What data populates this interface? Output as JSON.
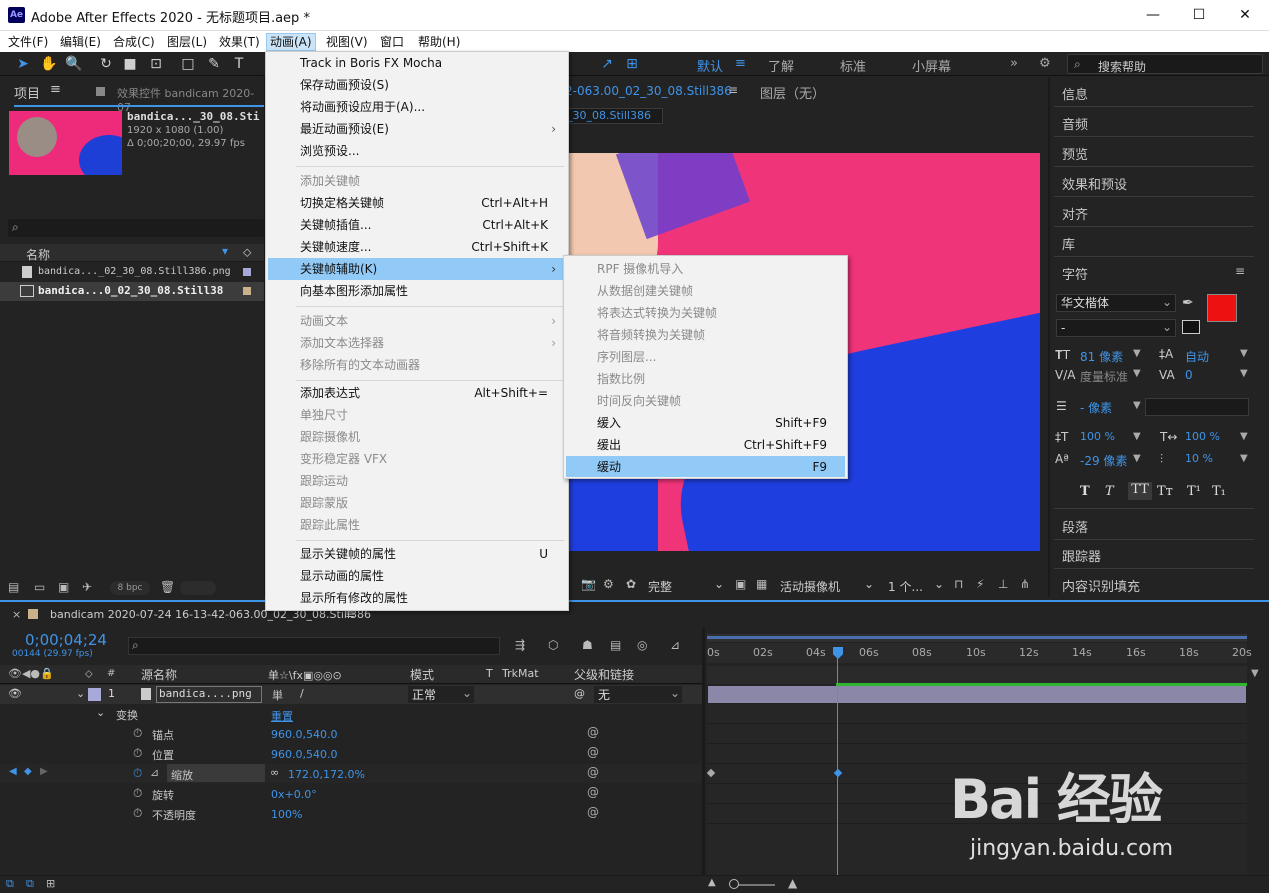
{
  "window": {
    "app_logo": "Ae",
    "title": "Adobe After Effects 2020 - 无标题项目.aep *",
    "minimize": "—",
    "maximize": "☐",
    "close": "✕"
  },
  "menubar": [
    {
      "label": "文件(F)"
    },
    {
      "label": "编辑(E)"
    },
    {
      "label": "合成(C)"
    },
    {
      "label": "图层(L)"
    },
    {
      "label": "效果(T)"
    },
    {
      "label": "动画(A)"
    },
    {
      "label": "视图(V)"
    },
    {
      "label": "窗口"
    },
    {
      "label": "帮助(H)"
    }
  ],
  "toolbar": {
    "workspaces": [
      "默认",
      "了解",
      "标准",
      "小屏幕"
    ],
    "search_placeholder": "搜索帮助"
  },
  "project_panel": {
    "tab_project": "项目",
    "tab_effects": "效果控件 bandicam 2020-07",
    "file_name": "bandica..._30_08.Sti",
    "file_dims": "1920 x 1080 (1.00)",
    "file_duration": "Δ 0;00;20;00, 29.97 fps",
    "column_name": "名称",
    "items": [
      {
        "name": "bandica..._02_30_08.Still386.png"
      },
      {
        "name": "bandica...0_02_30_08.Still38"
      }
    ],
    "bpc": "8 bpc"
  },
  "viewer": {
    "comp_tab": "2-063.00_02_30_08.Still386",
    "layer_tab": "图层（无）",
    "sub_tab": "_30_08.Still386",
    "quality": "完整",
    "camera": "活动摄像机",
    "views": "1 个..."
  },
  "right_panel": {
    "items": [
      "信息",
      "音频",
      "预览",
      "效果和预设",
      "对齐",
      "库"
    ],
    "character_title": "字符",
    "font_name": "华文楷体",
    "font_style": "-",
    "font_size": "81 像素",
    "leading": "自动",
    "kerning": "度量标准",
    "tracking": "0",
    "stroke_width": "- 像素",
    "vert_scale": "100 %",
    "horiz_scale": "100 %",
    "baseline": "-29 像素",
    "tsume": "10 %",
    "fill_color": "#ee1111",
    "type_buttons": [
      "T",
      "T",
      "TT",
      "Tт",
      "T¹",
      "T₁"
    ],
    "bottom_items": [
      "段落",
      "跟踪器",
      "内容识别填充"
    ]
  },
  "animation_menu": {
    "items": [
      {
        "label": "Track in Boris FX Mocha",
        "shortcut": "",
        "disabled": false
      },
      {
        "label": "保存动画预设(S)",
        "shortcut": "",
        "disabled": false
      },
      {
        "label": "将动画预设应用于(A)...",
        "shortcut": "",
        "disabled": false
      },
      {
        "label": "最近动画预设(E)",
        "shortcut": "",
        "disabled": false,
        "submenu": true
      },
      {
        "label": "浏览预设...",
        "shortcut": "",
        "disabled": false
      },
      {
        "label": "添加关键帧",
        "shortcut": "",
        "disabled": true
      },
      {
        "label": "切换定格关键帧",
        "shortcut": "Ctrl+Alt+H",
        "disabled": false
      },
      {
        "label": "关键帧插值...",
        "shortcut": "Ctrl+Alt+K",
        "disabled": false
      },
      {
        "label": "关键帧速度...",
        "shortcut": "Ctrl+Shift+K",
        "disabled": false
      },
      {
        "label": "关键帧辅助(K)",
        "shortcut": "",
        "disabled": false,
        "submenu": true,
        "highlighted": true
      },
      {
        "label": "向基本图形添加属性",
        "shortcut": "",
        "disabled": false
      },
      {
        "label": "动画文本",
        "shortcut": "",
        "disabled": true,
        "submenu": true
      },
      {
        "label": "添加文本选择器",
        "shortcut": "",
        "disabled": true,
        "submenu": true
      },
      {
        "label": "移除所有的文本动画器",
        "shortcut": "",
        "disabled": true
      },
      {
        "label": "添加表达式",
        "shortcut": "Alt+Shift+=",
        "disabled": false
      },
      {
        "label": "单独尺寸",
        "shortcut": "",
        "disabled": true
      },
      {
        "label": "跟踪摄像机",
        "shortcut": "",
        "disabled": true
      },
      {
        "label": "变形稳定器 VFX",
        "shortcut": "",
        "disabled": true
      },
      {
        "label": "跟踪运动",
        "shortcut": "",
        "disabled": true
      },
      {
        "label": "跟踪蒙版",
        "shortcut": "",
        "disabled": true
      },
      {
        "label": "跟踪此属性",
        "shortcut": "",
        "disabled": true
      },
      {
        "label": "显示关键帧的属性",
        "shortcut": "U",
        "disabled": false
      },
      {
        "label": "显示动画的属性",
        "shortcut": "",
        "disabled": false
      },
      {
        "label": "显示所有修改的属性",
        "shortcut": "",
        "disabled": false
      }
    ]
  },
  "keyframe_assistant_menu": {
    "items": [
      {
        "label": "RPF 摄像机导入",
        "shortcut": "",
        "disabled": true
      },
      {
        "label": "从数据创建关键帧",
        "shortcut": "",
        "disabled": true
      },
      {
        "label": "将表达式转换为关键帧",
        "shortcut": "",
        "disabled": true
      },
      {
        "label": "将音频转换为关键帧",
        "shortcut": "",
        "disabled": true
      },
      {
        "label": "序列图层...",
        "shortcut": "",
        "disabled": true
      },
      {
        "label": "指数比例",
        "shortcut": "",
        "disabled": true
      },
      {
        "label": "时间反向关键帧",
        "shortcut": "",
        "disabled": true
      },
      {
        "label": "缓入",
        "shortcut": "Shift+F9",
        "disabled": false
      },
      {
        "label": "缓出",
        "shortcut": "Ctrl+Shift+F9",
        "disabled": false
      },
      {
        "label": "缓动",
        "shortcut": "F9",
        "disabled": false,
        "highlighted": true
      }
    ]
  },
  "timeline": {
    "comp_name": "bandicam 2020-07-24 16-13-42-063.00_02_30_08.Still386",
    "timecode": "0;00;04;24",
    "frame_info": "00144 (29.97 fps)",
    "col_source": "源名称",
    "col_switches": "单☆\\fx▣◎◎⊙",
    "col_mode": "模式",
    "col_t": "T",
    "col_trkmat": "TrkMat",
    "col_parent": "父级和链接",
    "layer": {
      "index": "1",
      "name": "bandica....png",
      "mode": "正常",
      "parent": "无"
    },
    "transform_label": "变换",
    "reset_label": "重置",
    "properties": [
      {
        "name": "锚点",
        "value": "960.0,540.0"
      },
      {
        "name": "位置",
        "value": "960.0,540.0"
      },
      {
        "name": "缩放",
        "value": "172.0,172.0%"
      },
      {
        "name": "旋转",
        "value": "0x+0.0°"
      },
      {
        "name": "不透明度",
        "value": "100%"
      }
    ],
    "ruler": [
      "0s",
      "02s",
      "04s",
      "06s",
      "08s",
      "10s",
      "12s",
      "14s",
      "16s",
      "18s",
      "20s"
    ]
  },
  "watermark": {
    "brand": "Bai 经验",
    "url": "jingyan.baidu.com"
  }
}
